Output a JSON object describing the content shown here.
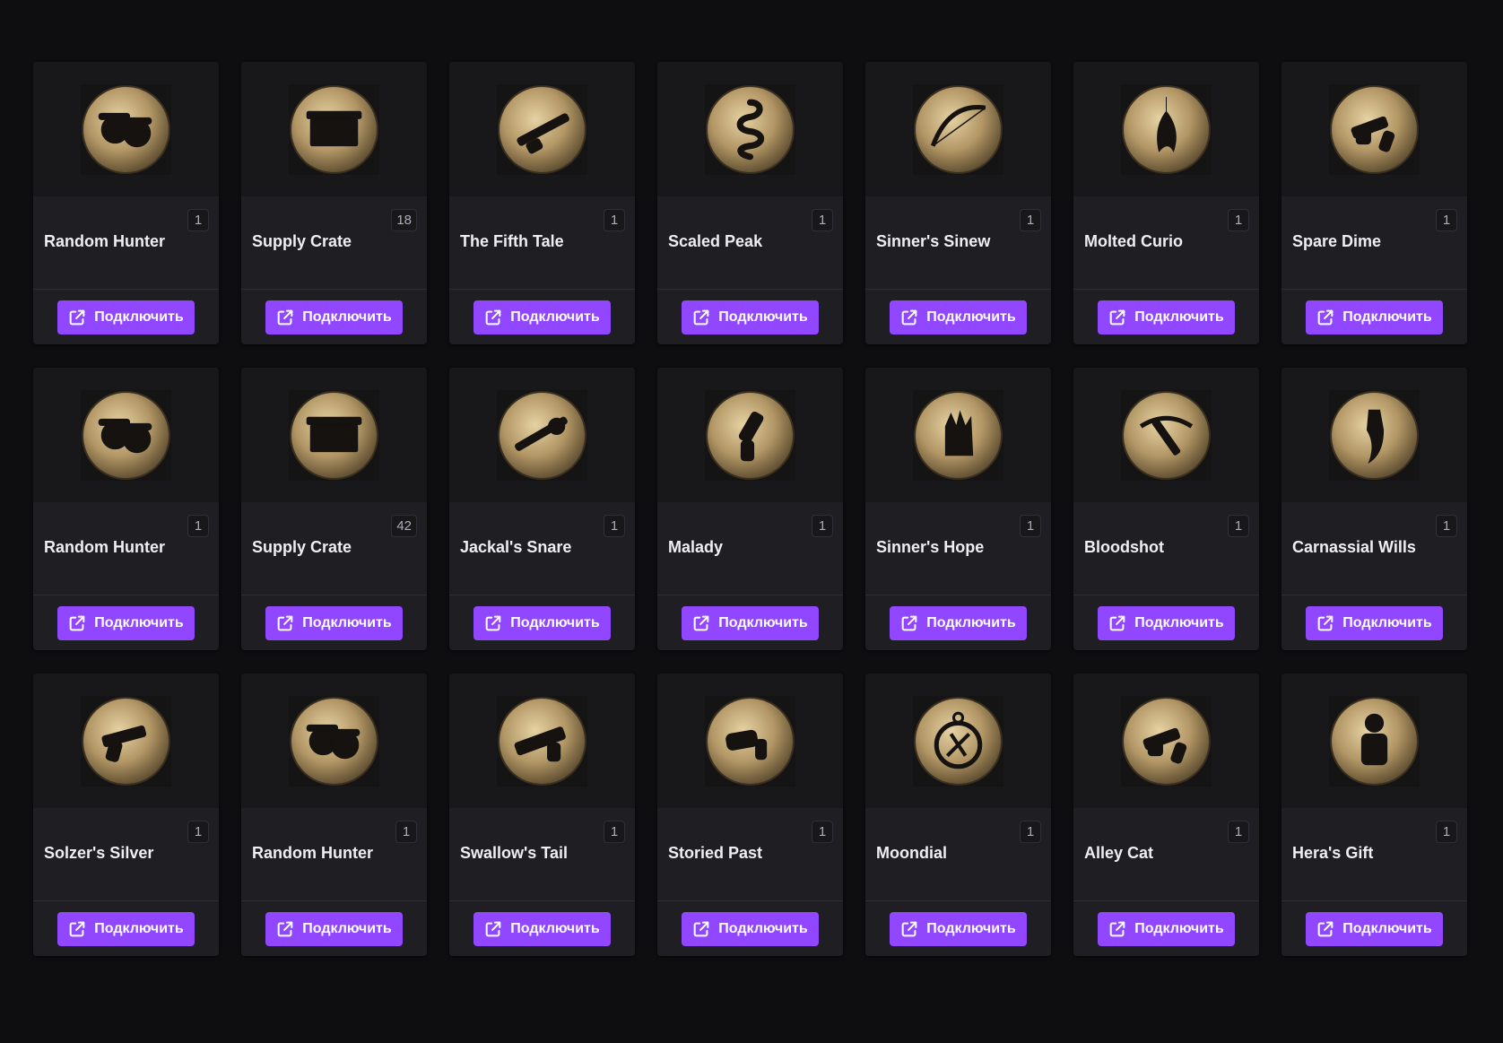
{
  "colors": {
    "page_bg": "#0e0e10",
    "card_bg": "#1f1f23",
    "card_image_bg": "#18181b",
    "accent": "#9147ff",
    "coin_gold": "#b39766"
  },
  "connect_label": "Подключить",
  "connect_icon": "external-link-icon",
  "rewards": [
    {
      "name": "Random Hunter",
      "count": "1",
      "icon": "hunters-duo-icon"
    },
    {
      "name": "Supply Crate",
      "count": "18",
      "icon": "supply-crate-icon"
    },
    {
      "name": "The Fifth Tale",
      "count": "1",
      "icon": "shotgun-icon"
    },
    {
      "name": "Scaled Peak",
      "count": "1",
      "icon": "coiled-serpent-icon"
    },
    {
      "name": "Sinner's Sinew",
      "count": "1",
      "icon": "bow-icon"
    },
    {
      "name": "Molted Curio",
      "count": "1",
      "icon": "feather-charm-icon"
    },
    {
      "name": "Spare Dime",
      "count": "1",
      "icon": "revolver-icon"
    },
    {
      "name": "Random Hunter",
      "count": "1",
      "icon": "hunters-duo-icon"
    },
    {
      "name": "Supply Crate",
      "count": "42",
      "icon": "supply-crate-icon"
    },
    {
      "name": "Jackal's Snare",
      "count": "1",
      "icon": "rifle-icon"
    },
    {
      "name": "Malady",
      "count": "1",
      "icon": "flare-pistol-icon"
    },
    {
      "name": "Sinner's Hope",
      "count": "1",
      "icon": "bound-hand-icon"
    },
    {
      "name": "Bloodshot",
      "count": "1",
      "icon": "crossbow-icon"
    },
    {
      "name": "Carnassial Wills",
      "count": "1",
      "icon": "tooth-charm-icon"
    },
    {
      "name": "Solzer's Silver",
      "count": "1",
      "icon": "pistol-icon"
    },
    {
      "name": "Random Hunter",
      "count": "1",
      "icon": "hunters-duo-icon"
    },
    {
      "name": "Swallow's Tail",
      "count": "1",
      "icon": "sawed-off-icon"
    },
    {
      "name": "Storied Past",
      "count": "1",
      "icon": "pepperbox-icon"
    },
    {
      "name": "Moondial",
      "count": "1",
      "icon": "compass-charm-icon"
    },
    {
      "name": "Alley Cat",
      "count": "1",
      "icon": "revolver-icon"
    },
    {
      "name": "Hera's Gift",
      "count": "1",
      "icon": "skull-bundle-icon"
    }
  ]
}
